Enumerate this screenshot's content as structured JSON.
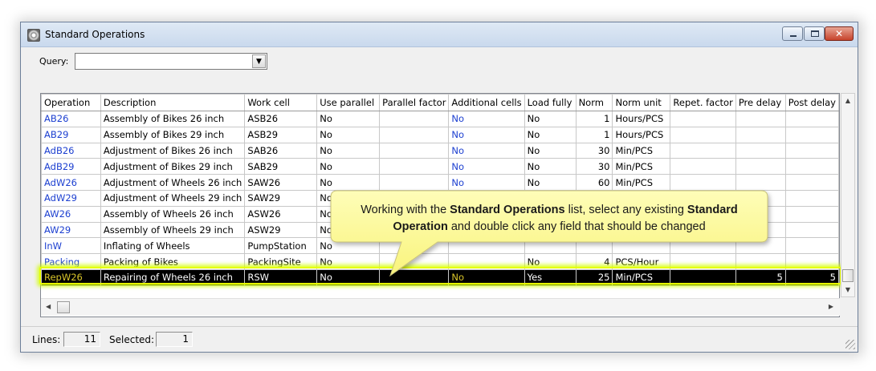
{
  "window": {
    "title": "Standard Operations"
  },
  "query": {
    "label": "Query:",
    "value": ""
  },
  "grid": {
    "columns": [
      "Operation",
      "Description",
      "Work cell",
      "Use parallel",
      "Parallel factor",
      "Additional cells",
      "Load fully",
      "Norm",
      "Norm unit",
      "Repet. factor",
      "Pre delay",
      "Post delay"
    ],
    "rows": [
      [
        "AB26",
        "Assembly of Bikes 26 inch",
        "ASB26",
        "No",
        "",
        "No",
        "No",
        "1",
        "Hours/PCS",
        "",
        "",
        ""
      ],
      [
        "AB29",
        "Assembly of Bikes 29 inch",
        "ASB29",
        "No",
        "",
        "No",
        "No",
        "1",
        "Hours/PCS",
        "",
        "",
        ""
      ],
      [
        "AdB26",
        "Adjustment of Bikes 26 inch",
        "SAB26",
        "No",
        "",
        "No",
        "No",
        "30",
        "Min/PCS",
        "",
        "",
        ""
      ],
      [
        "AdB29",
        "Adjustment of Bikes 29 inch",
        "SAB29",
        "No",
        "",
        "No",
        "No",
        "30",
        "Min/PCS",
        "",
        "",
        ""
      ],
      [
        "AdW26",
        "Adjustment of Wheels 26 inch",
        "SAW26",
        "No",
        "",
        "No",
        "No",
        "60",
        "Min/PCS",
        "",
        "",
        ""
      ],
      [
        "AdW29",
        "Adjustment of Wheels 29 inch",
        "SAW29",
        "No",
        "",
        "",
        "",
        "",
        "",
        "",
        "",
        ""
      ],
      [
        "AW26",
        "Assembly of Wheels 26 inch",
        "ASW26",
        "No",
        "",
        "",
        "",
        "",
        "",
        "",
        "",
        ""
      ],
      [
        "AW29",
        "Assembly of Wheels 29 inch",
        "ASW29",
        "No",
        "",
        "",
        "",
        "",
        "",
        "",
        "",
        ""
      ],
      [
        "InW",
        "Inflating of Wheels",
        "PumpStation",
        "No",
        "",
        "",
        "",
        "",
        "",
        "",
        "",
        ""
      ],
      [
        "Packing",
        "Packing of Bikes",
        "PackingSite",
        "No",
        "",
        "",
        "No",
        "4",
        "PCS/Hour",
        "",
        "",
        ""
      ],
      [
        "RepW26",
        "Repairing of Wheels 26 inch",
        "RSW",
        "No",
        "",
        "No",
        "Yes",
        "25",
        "Min/PCS",
        "",
        "5",
        "5"
      ]
    ],
    "selected_row": 10
  },
  "status": {
    "lines_label": "Lines:",
    "lines_value": "11",
    "selected_label": "Selected:",
    "selected_value": "1"
  },
  "callout": {
    "part1": "Working with the ",
    "bold1": "Standard Operations",
    "part2": " list, select any existing ",
    "bold2": "Standard Operation",
    "part3": " and double click any field that should be changed"
  },
  "colors": {
    "link": "#1c3fd0",
    "selected_bg": "#000000",
    "selected_code": "#d9c52a",
    "highlight": "#e6ff00",
    "callout_fill": "#fdfb9c"
  },
  "icons": {
    "app": "gear-icon",
    "minimize": "minimize-icon",
    "maximize": "maximize-icon",
    "close": "close-icon",
    "dropdown": "chevron-down-icon"
  }
}
